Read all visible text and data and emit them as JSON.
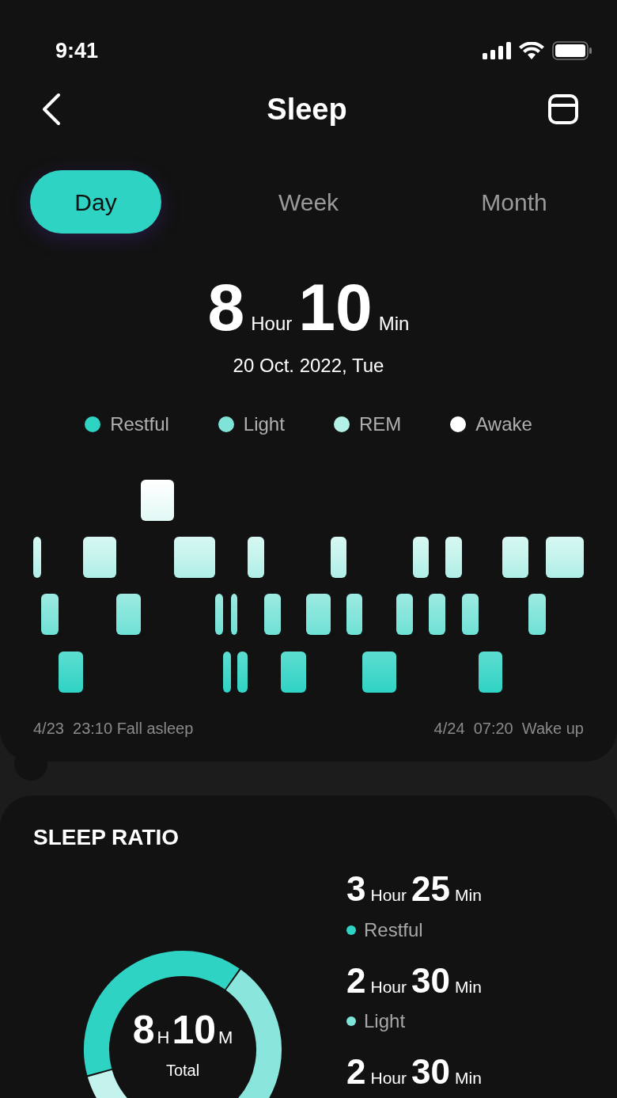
{
  "status_bar": {
    "time": "9:41"
  },
  "header": {
    "title": "Sleep"
  },
  "tabs": [
    {
      "label": "Day",
      "selected": true
    },
    {
      "label": "Week",
      "selected": false
    },
    {
      "label": "Month",
      "selected": false
    }
  ],
  "summary": {
    "hours": "8",
    "hour_unit": "Hour",
    "minutes": "10",
    "minute_unit": "Min",
    "date": "20 Oct. 2022, Tue"
  },
  "legend": [
    {
      "label": "Restful",
      "color": "#2fd3c4"
    },
    {
      "label": "Light",
      "color": "#7fe3d8"
    },
    {
      "label": "REM",
      "color": "#b3f0e8"
    },
    {
      "label": "Awake",
      "color": "#ffffff"
    }
  ],
  "timeline": {
    "start": "4/23  23:10 Fall asleep",
    "end": "4/24  07:20  Wake up"
  },
  "sleep_ratio": {
    "title": "SLEEP RATIO",
    "total": {
      "hours": "8",
      "hour_unit": "H",
      "minutes": "10",
      "minute_unit": "M",
      "label": "Total"
    },
    "stats": [
      {
        "hours": "3",
        "hour_unit": "Hour",
        "minutes": "25",
        "minute_unit": "Min",
        "label": "Restful",
        "color": "#2fd3c4"
      },
      {
        "hours": "2",
        "hour_unit": "Hour",
        "minutes": "30",
        "minute_unit": "Min",
        "label": "Light",
        "color": "#7fe3d8"
      },
      {
        "hours": "2",
        "hour_unit": "Hour",
        "minutes": "30",
        "minute_unit": "Min"
      }
    ]
  }
}
